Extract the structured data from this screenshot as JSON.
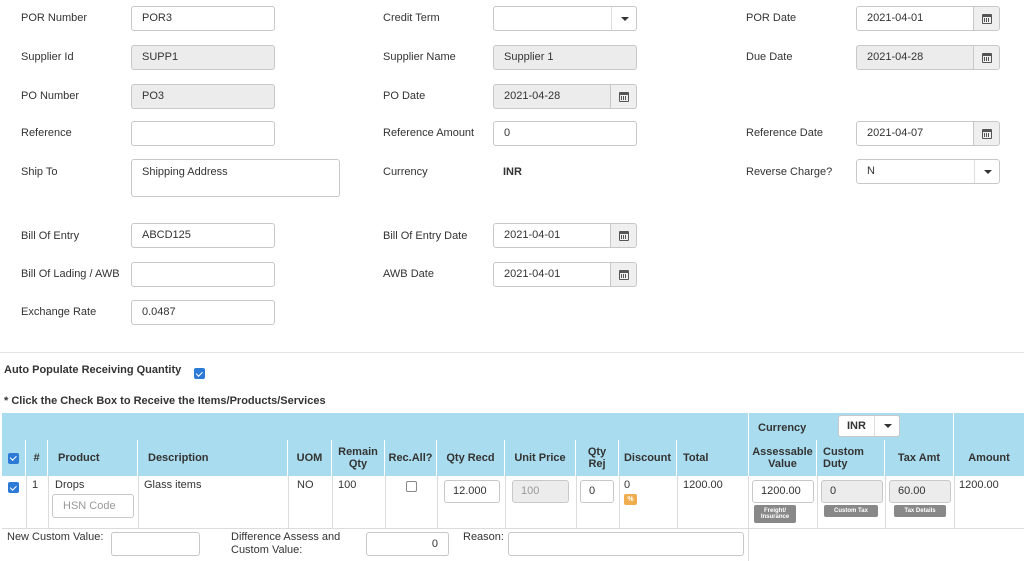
{
  "form": {
    "por_number": {
      "label": "POR Number",
      "value": "POR3"
    },
    "credit_term": {
      "label": "Credit Term",
      "value": ""
    },
    "por_date": {
      "label": "POR Date",
      "value": "2021-04-01"
    },
    "supplier_id": {
      "label": "Supplier Id",
      "value": "SUPP1"
    },
    "supplier_name": {
      "label": "Supplier Name",
      "value": "Supplier 1"
    },
    "due_date": {
      "label": "Due Date",
      "value": "2021-04-28"
    },
    "po_number": {
      "label": "PO Number",
      "value": "PO3"
    },
    "po_date": {
      "label": "PO Date",
      "value": "2021-04-28"
    },
    "reference": {
      "label": "Reference",
      "value": ""
    },
    "reference_amount": {
      "label": "Reference Amount",
      "value": "0"
    },
    "reference_date": {
      "label": "Reference Date",
      "value": "2021-04-07"
    },
    "ship_to": {
      "label": "Ship To",
      "value": "Shipping Address"
    },
    "currency": {
      "label": "Currency",
      "value": "INR"
    },
    "reverse_charge": {
      "label": "Reverse Charge?",
      "value": "N"
    },
    "bill_of_entry": {
      "label": "Bill Of Entry",
      "value": "ABCD125"
    },
    "bill_of_entry_date": {
      "label": "Bill Of Entry Date",
      "value": "2021-04-01"
    },
    "bill_of_lading": {
      "label": "Bill Of Lading / AWB",
      "value": ""
    },
    "awb_date": {
      "label": "AWB Date",
      "value": "2021-04-01"
    },
    "exchange_rate": {
      "label": "Exchange Rate",
      "value": "0.0487"
    }
  },
  "auto_populate_label": "Auto Populate Receiving Quantity",
  "instruction": "* Click the Check Box to Receive the Items/Products/Services",
  "table": {
    "currency_label": "Currency",
    "currency_value": "INR",
    "headers": {
      "num": "#",
      "product": "Product",
      "description": "Description",
      "uom": "UOM",
      "remain_qty": "Remain Qty",
      "rec_all": "Rec.All?",
      "qty_recd": "Qty Recd",
      "unit_price": "Unit Price",
      "qty_rej": "Qty Rej",
      "discount": "Discount",
      "total": "Total",
      "assessable_value": "Assessable Value",
      "custom_duty": "Custom Duty",
      "tax_amt": "Tax Amt",
      "amount": "Amount"
    },
    "row": {
      "num": "1",
      "product": "Drops",
      "hsn_placeholder": "HSN Code",
      "description": "Glass items",
      "uom": "NO",
      "remain_qty": "100",
      "qty_recd": "12.000",
      "unit_price": "100",
      "qty_rej": "0",
      "discount": "0",
      "discount_badge": "%",
      "total": "1200.00",
      "assessable_value": "1200.00",
      "freight_button": "Freight/ Insurance",
      "custom_duty": "0",
      "custom_tax_button": "Custom Tax",
      "tax_amt": "60.00",
      "tax_details_button": "Tax Details",
      "amount": "1200.00"
    }
  },
  "footer": {
    "new_custom_value_label": "New Custom Value:",
    "new_custom_value": "",
    "difference_label": "Difference Assess and Custom Value:",
    "difference_value": "0",
    "reason_label": "Reason:",
    "reason_value": ""
  }
}
